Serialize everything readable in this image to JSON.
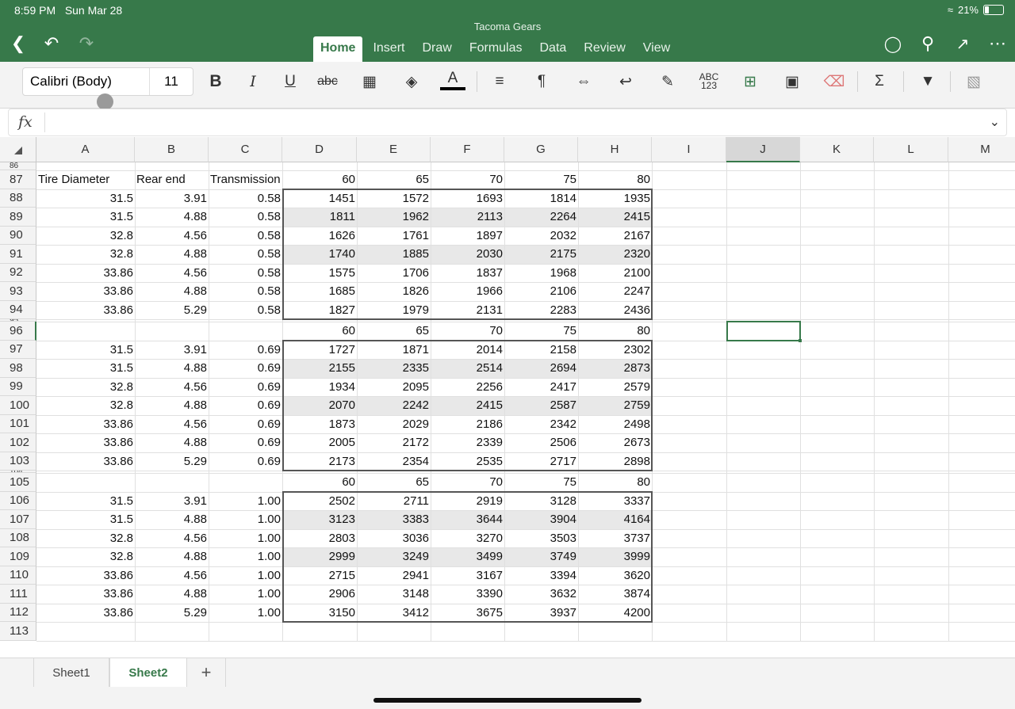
{
  "status": {
    "time": "8:59 PM",
    "date": "Sun Mar 28",
    "battery": "21%"
  },
  "app": {
    "title": "Tacoma Gears"
  },
  "tabs": [
    "Home",
    "Insert",
    "Draw",
    "Formulas",
    "Data",
    "Review",
    "View"
  ],
  "active_tab": "Home",
  "ribbon": {
    "font_name": "Calibri (Body)",
    "font_size": "11",
    "icons": [
      "bold-icon",
      "italic-icon",
      "underline-icon",
      "strikethrough-icon",
      "borders-icon",
      "fill-color-icon",
      "font-color-icon",
      "align-icon",
      "paragraph-icon",
      "merge-icon",
      "wrap-icon",
      "format-painter-icon",
      "number-format-icon",
      "insert-delete-icon",
      "format-icon",
      "clear-icon",
      "sum-icon",
      "sort-filter-icon",
      "more-icon"
    ]
  },
  "formula_bar": {
    "label": "fx",
    "value": ""
  },
  "columns": [
    "A",
    "B",
    "C",
    "D",
    "E",
    "F",
    "G",
    "H",
    "I",
    "J",
    "K",
    "L",
    "M"
  ],
  "selected_column": "J",
  "selected_row": "96",
  "rows": [
    {
      "n": "86",
      "cells": []
    },
    {
      "n": "87",
      "cells": [
        "Tire Diameter",
        "Rear end",
        "Transmission",
        "60",
        "65",
        "70",
        "75",
        "80"
      ]
    },
    {
      "n": "88",
      "cells": [
        "31.5",
        "3.91",
        "0.58",
        "1451",
        "1572",
        "1693",
        "1814",
        "1935"
      ]
    },
    {
      "n": "89",
      "cells": [
        "31.5",
        "4.88",
        "0.58",
        "1811",
        "1962",
        "2113",
        "2264",
        "2415"
      ]
    },
    {
      "n": "90",
      "cells": [
        "32.8",
        "4.56",
        "0.58",
        "1626",
        "1761",
        "1897",
        "2032",
        "2167"
      ]
    },
    {
      "n": "91",
      "cells": [
        "32.8",
        "4.88",
        "0.58",
        "1740",
        "1885",
        "2030",
        "2175",
        "2320"
      ]
    },
    {
      "n": "92",
      "cells": [
        "33.86",
        "4.56",
        "0.58",
        "1575",
        "1706",
        "1837",
        "1968",
        "2100"
      ]
    },
    {
      "n": "93",
      "cells": [
        "33.86",
        "4.88",
        "0.58",
        "1685",
        "1826",
        "1966",
        "2106",
        "2247"
      ]
    },
    {
      "n": "94",
      "cells": [
        "33.86",
        "5.29",
        "0.58",
        "1827",
        "1979",
        "2131",
        "2283",
        "2436"
      ]
    },
    {
      "n": "95",
      "cells": []
    },
    {
      "n": "96",
      "cells": [
        "",
        "",
        "",
        "60",
        "65",
        "70",
        "75",
        "80"
      ]
    },
    {
      "n": "97",
      "cells": [
        "31.5",
        "3.91",
        "0.69",
        "1727",
        "1871",
        "2014",
        "2158",
        "2302"
      ]
    },
    {
      "n": "98",
      "cells": [
        "31.5",
        "4.88",
        "0.69",
        "2155",
        "2335",
        "2514",
        "2694",
        "2873"
      ]
    },
    {
      "n": "99",
      "cells": [
        "32.8",
        "4.56",
        "0.69",
        "1934",
        "2095",
        "2256",
        "2417",
        "2579"
      ]
    },
    {
      "n": "100",
      "cells": [
        "32.8",
        "4.88",
        "0.69",
        "2070",
        "2242",
        "2415",
        "2587",
        "2759"
      ]
    },
    {
      "n": "101",
      "cells": [
        "33.86",
        "4.56",
        "0.69",
        "1873",
        "2029",
        "2186",
        "2342",
        "2498"
      ]
    },
    {
      "n": "102",
      "cells": [
        "33.86",
        "4.88",
        "0.69",
        "2005",
        "2172",
        "2339",
        "2506",
        "2673"
      ]
    },
    {
      "n": "103",
      "cells": [
        "33.86",
        "5.29",
        "0.69",
        "2173",
        "2354",
        "2535",
        "2717",
        "2898"
      ]
    },
    {
      "n": "104",
      "cells": []
    },
    {
      "n": "105",
      "cells": [
        "",
        "",
        "",
        "60",
        "65",
        "70",
        "75",
        "80"
      ]
    },
    {
      "n": "106",
      "cells": [
        "31.5",
        "3.91",
        "1.00",
        "2502",
        "2711",
        "2919",
        "3128",
        "3337"
      ]
    },
    {
      "n": "107",
      "cells": [
        "31.5",
        "4.88",
        "1.00",
        "3123",
        "3383",
        "3644",
        "3904",
        "4164"
      ]
    },
    {
      "n": "108",
      "cells": [
        "32.8",
        "4.56",
        "1.00",
        "2803",
        "3036",
        "3270",
        "3503",
        "3737"
      ]
    },
    {
      "n": "109",
      "cells": [
        "32.8",
        "4.88",
        "1.00",
        "2999",
        "3249",
        "3499",
        "3749",
        "3999"
      ]
    },
    {
      "n": "110",
      "cells": [
        "33.86",
        "4.56",
        "1.00",
        "2715",
        "2941",
        "3167",
        "3394",
        "3620"
      ]
    },
    {
      "n": "111",
      "cells": [
        "33.86",
        "4.88",
        "1.00",
        "2906",
        "3148",
        "3390",
        "3632",
        "3874"
      ]
    },
    {
      "n": "112",
      "cells": [
        "33.86",
        "5.29",
        "1.00",
        "3150",
        "3412",
        "3675",
        "3937",
        "4200"
      ]
    },
    {
      "n": "113",
      "cells": []
    }
  ],
  "shaded_rows": [
    "89",
    "91",
    "98",
    "100",
    "107",
    "109"
  ],
  "sheets": [
    "Sheet1",
    "Sheet2"
  ],
  "active_sheet": "Sheet2"
}
